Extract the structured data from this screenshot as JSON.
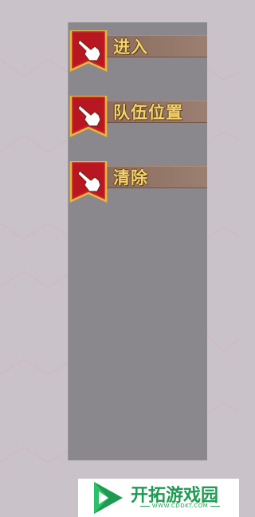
{
  "menu": {
    "items": [
      {
        "label": "进入",
        "icon": "hand-pointer-icon"
      },
      {
        "label": "队伍位置",
        "icon": "hand-pointer-icon"
      },
      {
        "label": "清除",
        "icon": "hand-pointer-icon"
      }
    ]
  },
  "watermark": {
    "title": "开拓游戏园",
    "url": "WWW.CDDKT.COM"
  },
  "colors": {
    "background": "#c9c3c9",
    "panel": "#8a888d",
    "badge_red": "#c8202a",
    "badge_gold": "#e6b93a",
    "label_gold": "#f3d36a",
    "watermark_green": "#1f9a52"
  }
}
